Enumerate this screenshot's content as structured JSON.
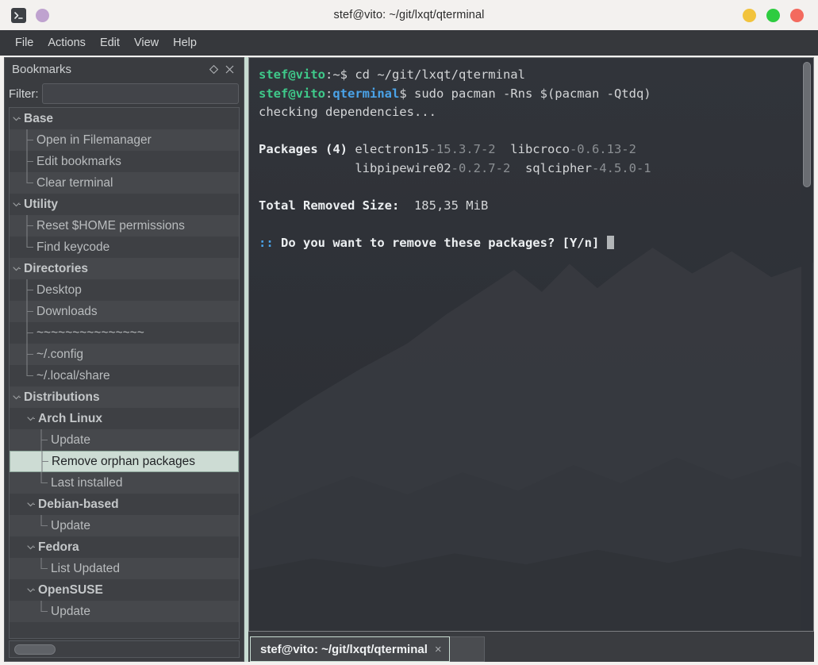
{
  "window": {
    "title": "stef@vito: ~/git/lxqt/qterminal",
    "app_icon": "terminal-icon",
    "secondary_icon": "purple-circle-icon",
    "controls": [
      {
        "name": "minimize",
        "color": "#f2c33c"
      },
      {
        "name": "maximize",
        "color": "#2ecc40"
      },
      {
        "name": "close",
        "color": "#f36a5e"
      }
    ]
  },
  "menubar": {
    "items": [
      "File",
      "Actions",
      "Edit",
      "View",
      "Help"
    ]
  },
  "dock": {
    "title": "Bookmarks",
    "float_icon": "float-diamond-icon",
    "close_icon": "close-icon",
    "filter": {
      "label": "Filter:",
      "value": "",
      "placeholder": ""
    },
    "tree": [
      {
        "label": "Base",
        "level": 0,
        "type": "group",
        "selected": false
      },
      {
        "label": "Open in Filemanager",
        "level": 1,
        "type": "leaf",
        "selected": false
      },
      {
        "label": "Edit bookmarks",
        "level": 1,
        "type": "leaf",
        "selected": false
      },
      {
        "label": "Clear terminal",
        "level": 1,
        "type": "leaf",
        "selected": false,
        "last": true
      },
      {
        "label": "Utility",
        "level": 0,
        "type": "group",
        "selected": false
      },
      {
        "label": "Reset $HOME permissions",
        "level": 1,
        "type": "leaf",
        "selected": false
      },
      {
        "label": "Find keycode",
        "level": 1,
        "type": "leaf",
        "selected": false,
        "last": true
      },
      {
        "label": "Directories",
        "level": 0,
        "type": "group",
        "selected": false
      },
      {
        "label": "Desktop",
        "level": 1,
        "type": "leaf",
        "selected": false
      },
      {
        "label": "Downloads",
        "level": 1,
        "type": "leaf",
        "selected": false
      },
      {
        "label": "~~~~~~~~~~~~~~~",
        "level": 1,
        "type": "leaf",
        "selected": false
      },
      {
        "label": "~/.config",
        "level": 1,
        "type": "leaf",
        "selected": false
      },
      {
        "label": "~/.local/share",
        "level": 1,
        "type": "leaf",
        "selected": false,
        "last": true
      },
      {
        "label": "Distributions",
        "level": 0,
        "type": "group",
        "selected": false
      },
      {
        "label": "Arch Linux",
        "level": 1,
        "type": "group",
        "selected": false
      },
      {
        "label": "Update",
        "level": 2,
        "type": "leaf",
        "selected": false
      },
      {
        "label": "Remove orphan packages",
        "level": 2,
        "type": "leaf",
        "selected": true
      },
      {
        "label": "Last installed",
        "level": 2,
        "type": "leaf",
        "selected": false,
        "last": true
      },
      {
        "label": "Debian-based",
        "level": 1,
        "type": "group",
        "selected": false
      },
      {
        "label": "Update",
        "level": 2,
        "type": "leaf",
        "selected": false,
        "last": true
      },
      {
        "label": "Fedora",
        "level": 1,
        "type": "group",
        "selected": false
      },
      {
        "label": "List Updated",
        "level": 2,
        "type": "leaf",
        "selected": false,
        "last": true
      },
      {
        "label": "OpenSUSE",
        "level": 1,
        "type": "group",
        "selected": false
      },
      {
        "label": "Update",
        "level": 2,
        "type": "leaf",
        "selected": false,
        "last": true
      }
    ]
  },
  "terminal": {
    "lines": [
      [
        {
          "t": "stef@vito",
          "c": "user"
        },
        {
          "t": ":~$ ",
          "c": "plain"
        },
        {
          "t": "cd ~/git/lxqt/qterminal",
          "c": "plain"
        }
      ],
      [
        {
          "t": "stef@vito",
          "c": "user"
        },
        {
          "t": ":",
          "c": "plain"
        },
        {
          "t": "qterminal",
          "c": "path"
        },
        {
          "t": "$ sudo pacman -Rns $(pacman -Qtdq)",
          "c": "plain"
        }
      ],
      [
        {
          "t": "checking dependencies...",
          "c": "plain"
        }
      ],
      [
        {
          "t": "",
          "c": "plain"
        }
      ],
      [
        {
          "t": "Packages (4)",
          "c": "bold"
        },
        {
          "t": " electron15",
          "c": "plain"
        },
        {
          "t": "-15.3.7-2",
          "c": "dim"
        },
        {
          "t": "  libcroco",
          "c": "plain"
        },
        {
          "t": "-0.6.13-2",
          "c": "dim"
        }
      ],
      [
        {
          "t": "             libpipewire02",
          "c": "plain"
        },
        {
          "t": "-0.2.7-2",
          "c": "dim"
        },
        {
          "t": "  sqlcipher",
          "c": "plain"
        },
        {
          "t": "-4.5.0-1",
          "c": "dim"
        }
      ],
      [
        {
          "t": "",
          "c": "plain"
        }
      ],
      [
        {
          "t": "Total Removed Size:",
          "c": "bold"
        },
        {
          "t": "  185,35 MiB",
          "c": "plain"
        }
      ],
      [
        {
          "t": "",
          "c": "plain"
        }
      ],
      [
        {
          "t": "::",
          "c": "blue"
        },
        {
          "t": " Do you want to remove these packages? [Y/n] ",
          "c": "bold"
        },
        {
          "t": "",
          "c": "cursor"
        }
      ]
    ],
    "scrollbar": "vertical-scrollbar"
  },
  "tabbar": {
    "tabs": [
      {
        "label": "stef@vito: ~/git/lxqt/qterminal",
        "close": "×",
        "active": true
      }
    ]
  }
}
